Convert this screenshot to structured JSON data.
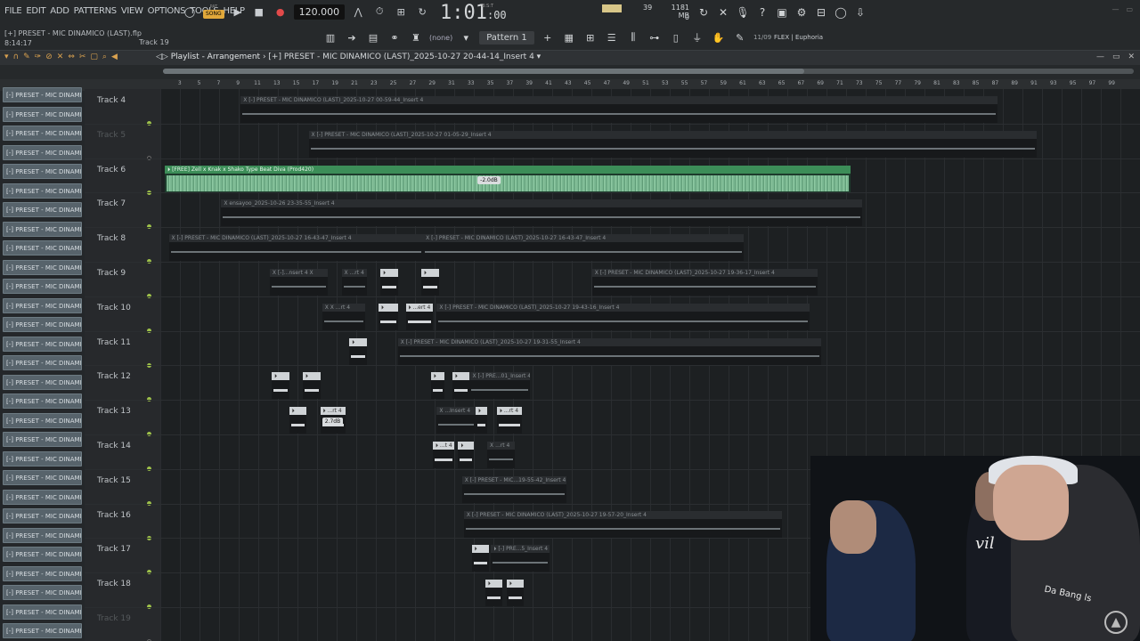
{
  "menu": [
    "FILE",
    "EDIT",
    "ADD",
    "PATTERNS",
    "VIEW",
    "OPTIONS",
    "TOOLS",
    "HELP"
  ],
  "file_title": "[+] PRESET - MIC DINAMICO (LAST).flp",
  "time_small": "8:14:17",
  "hint_track": "Track 19",
  "transport": {
    "mode_top": "PAT",
    "mode_bottom": "SONG",
    "tempo": "120.000",
    "clock_main": "1:01",
    "clock_small": ":00",
    "clock_unit": "B:S:T"
  },
  "perf": {
    "cpu": "39",
    "mem_mb": "1181 MB",
    "mem_voices": "0"
  },
  "toolbar": {
    "snap": "(none)",
    "pattern": "Pattern 1",
    "poly": "11/09",
    "flex": "FLEX | Euphoria"
  },
  "playlist": {
    "title_prefix": "Playlist - Arrangement",
    "title_file": "[+] PRESET - MIC DINAMICO (LAST)_2025-10-27 20-44-14_Insert 4",
    "ruler": [
      "3",
      "5",
      "7",
      "9",
      "11",
      "13",
      "15",
      "17",
      "19",
      "21",
      "23",
      "25",
      "27",
      "29",
      "31",
      "33",
      "35",
      "37",
      "39",
      "41",
      "43",
      "45",
      "47",
      "49",
      "51",
      "53",
      "55",
      "57",
      "59",
      "61",
      "63",
      "65",
      "67",
      "69",
      "71",
      "73",
      "75",
      "77",
      "79",
      "81",
      "83",
      "85",
      "87",
      "89",
      "91",
      "93",
      "95",
      "97",
      "99"
    ]
  },
  "channels": [
    "[-] PRESET - MIC DINAMI",
    "[-] PRESET - MIC DINAMI",
    "[-] PRESET - MIC DINAMI",
    "[-] PRESET - MIC DINAMI",
    "[-] PRESET - MIC DINAMI",
    "[-] PRESET - MIC DINAMI",
    "[-] PRESET - MIC DINAMI",
    "[-] PRESET - MIC DINAMI",
    "[-] PRESET - MIC DINAMI",
    "[-] PRESET - MIC DINAMI",
    "[-] PRESET - MIC DINAMI",
    "[-] PRESET - MIC DINAMI",
    "[-] PRESET - MIC DINAMI",
    "[-] PRESET - MIC DINAMI",
    "[-] PRESET - MIC DINAMI",
    "[-] PRESET - MIC DINAMI",
    "[-] PRESET - MIC DINAMI",
    "[-] PRESET - MIC DINAMI",
    "[-] PRESET - MIC DINAMI",
    "[-] PRESET - MIC DINAMI",
    "[-] PRESET - MIC DINAMI",
    "[-] PRESET - MIC DINAMI",
    "[-] PRESET - MIC DINAMI",
    "[-] PRESET - MIC DINAMI",
    "[-] PRESET - MIC DINAMI",
    "[-] PRESET - MIC DINAMI",
    "[-] PRESET - MIC DINAMI",
    "[-] PRESET - MIC DINAMI",
    "[-] PRESET - MIC DINAMI",
    "[-] PRESET - MIC DINAMI"
  ],
  "tracks": [
    {
      "label": "Track 4",
      "dim": false
    },
    {
      "label": "Track 5",
      "dim": true
    },
    {
      "label": "Track 6",
      "dim": false
    },
    {
      "label": "Track 7",
      "dim": false
    },
    {
      "label": "Track 8",
      "dim": false
    },
    {
      "label": "Track 9",
      "dim": false
    },
    {
      "label": "Track 10",
      "dim": false
    },
    {
      "label": "Track 11",
      "dim": false
    },
    {
      "label": "Track 12",
      "dim": false
    },
    {
      "label": "Track 13",
      "dim": false
    },
    {
      "label": "Track 14",
      "dim": false
    },
    {
      "label": "Track 15",
      "dim": false
    },
    {
      "label": "Track 16",
      "dim": false
    },
    {
      "label": "Track 17",
      "dim": false
    },
    {
      "label": "Track 18",
      "dim": false
    },
    {
      "label": "Track 19",
      "dim": true
    }
  ],
  "clips": [
    {
      "track": 0,
      "bar": 5,
      "len": 39,
      "label": "X [-] PRESET - MIC DINAMICO (LAST)_2025-10-27 00-59-44_Insert 4",
      "style": "dark"
    },
    {
      "track": 1,
      "bar": 8.5,
      "len": 37.5,
      "label": "X [-] PRESET - MIC DINAMICO (LAST)_2025-10-27 01-05-29_Insert 4",
      "style": "dark"
    },
    {
      "track": 2,
      "bar": 1.1,
      "len": 35.3,
      "label": "⏵ [FREE] Zell x Knak x Shako  Type Beat  Diva  (Prod420)",
      "style": "green"
    },
    {
      "track": 3,
      "bar": 4,
      "len": 33,
      "label": "X ensayoo_2025-10-26 23-35-55_Insert 4",
      "style": "dark"
    },
    {
      "track": 4,
      "bar": 1.3,
      "len": 13.1,
      "label": "X [-] PRESET - MIC DINAMICO (LAST)_2025-10-27 16-43-47_Insert 4",
      "style": "dark"
    },
    {
      "track": 4,
      "bar": 14.4,
      "len": 16.5,
      "label": "X [-] PRESET - MIC DINAMICO (LAST)_2025-10-27 16-43-47_Insert 4",
      "style": "dark"
    },
    {
      "track": 5,
      "bar": 6.5,
      "len": 3,
      "label": "X [-]...nsert 4  X",
      "style": "dark"
    },
    {
      "track": 5,
      "bar": 10.2,
      "len": 1.3,
      "label": "X ...rt 4",
      "style": "dark"
    },
    {
      "track": 5,
      "bar": 12.2,
      "len": 0.9,
      "label": "⏵",
      "style": "white"
    },
    {
      "track": 5,
      "bar": 14.3,
      "len": 0.9,
      "label": "⏵",
      "style": "white"
    },
    {
      "track": 5,
      "bar": 23.1,
      "len": 11.6,
      "label": "X [-] PRESET - MIC DINAMICO (LAST)_2025-10-27 19-36-17_Insert 4",
      "style": "dark"
    },
    {
      "track": 6,
      "bar": 9.2,
      "len": 2.2,
      "label": "X  X ...rt 4",
      "style": "dark"
    },
    {
      "track": 6,
      "bar": 12.1,
      "len": 1.0,
      "label": "⏵",
      "style": "white"
    },
    {
      "track": 6,
      "bar": 13.5,
      "len": 1.4,
      "label": "⏵ ...ert 4",
      "style": "white"
    },
    {
      "track": 6,
      "bar": 15.1,
      "len": 19.2,
      "label": "X [-] PRESET - MIC DINAMICO (LAST)_2025-10-27 19-43-16_Insert 4",
      "style": "dark"
    },
    {
      "track": 7,
      "bar": 10.6,
      "len": 0.9,
      "label": "⏵",
      "style": "white"
    },
    {
      "track": 7,
      "bar": 13.1,
      "len": 21.8,
      "label": "X [-] PRESET - MIC DINAMICO (LAST)_2025-10-27 19-31-55_Insert 4",
      "style": "dark"
    },
    {
      "track": 8,
      "bar": 6.6,
      "len": 0.9,
      "label": "⏵",
      "style": "white"
    },
    {
      "track": 8,
      "bar": 8.2,
      "len": 0.9,
      "label": "⏵",
      "style": "white"
    },
    {
      "track": 8,
      "bar": 14.8,
      "len": 0.7,
      "label": "⏵",
      "style": "white"
    },
    {
      "track": 8,
      "bar": 15.9,
      "len": 0.9,
      "label": "⏵",
      "style": "white"
    },
    {
      "track": 8,
      "bar": 16.8,
      "len": 3.1,
      "label": "X [-] PRE...01_Insert 4",
      "style": "dark"
    },
    {
      "track": 9,
      "bar": 7.5,
      "len": 0.9,
      "label": "⏵",
      "style": "white"
    },
    {
      "track": 9,
      "bar": 9.1,
      "len": 1.3,
      "label": "⏵ ...rt 4",
      "style": "white"
    },
    {
      "track": 9,
      "bar": 15.1,
      "len": 2,
      "label": "X ...Insert 4",
      "style": "dark"
    },
    {
      "track": 9,
      "bar": 17.1,
      "len": 0.6,
      "label": "⏵",
      "style": "white"
    },
    {
      "track": 9,
      "bar": 18.2,
      "len": 1.3,
      "label": "⏵ ...rt 4",
      "style": "white"
    },
    {
      "track": 10,
      "bar": 14.9,
      "len": 1.1,
      "label": "⏵ ...t 4",
      "style": "white"
    },
    {
      "track": 10,
      "bar": 16.2,
      "len": 0.8,
      "label": "⏵",
      "style": "white"
    },
    {
      "track": 10,
      "bar": 17.7,
      "len": 1.4,
      "label": "X ...rt 4",
      "style": "dark"
    },
    {
      "track": 11,
      "bar": 16.4,
      "len": 5.4,
      "label": "X [-] PRESET - MIC...19-55-42_Insert 4",
      "style": "dark"
    },
    {
      "track": 12,
      "bar": 16.5,
      "len": 16.4,
      "label": "X [-] PRESET - MIC DINAMICO (LAST)_2025-10-27 19-57-20_Insert 4",
      "style": "dark"
    },
    {
      "track": 13,
      "bar": 16.9,
      "len": 0.9,
      "label": "⏵",
      "style": "white"
    },
    {
      "track": 13,
      "bar": 17.9,
      "len": 3,
      "label": "⏵ [-] PRE...5_Insert 4",
      "style": "dark"
    },
    {
      "track": 14,
      "bar": 17.6,
      "len": 0.9,
      "label": "⏵",
      "style": "white"
    },
    {
      "track": 14,
      "bar": 18.7,
      "len": 0.9,
      "label": "⏵",
      "style": "white"
    }
  ],
  "vol_tags": [
    {
      "track": 2,
      "bar": 17.2,
      "text": "-2.0dB"
    },
    {
      "track": 9,
      "bar": 9.2,
      "text": "2.7dB"
    }
  ],
  "webcam": {
    "shirt_text": "vil",
    "hoodie_text": "Da Bang ls"
  }
}
